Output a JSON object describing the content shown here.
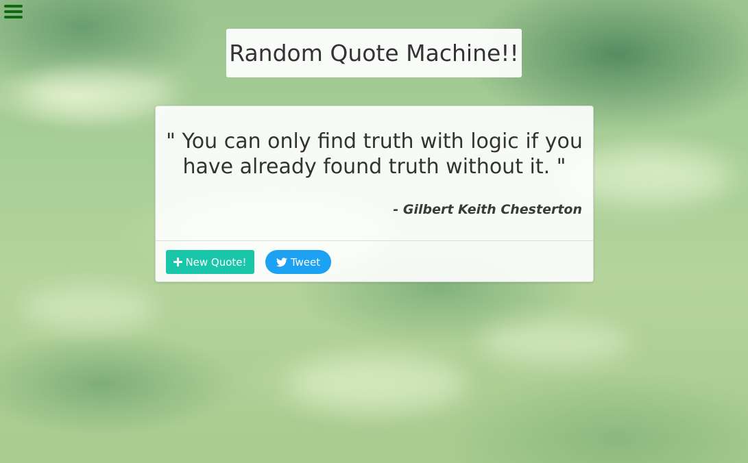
{
  "app": {
    "title": "Random Quote Machine!!"
  },
  "quote": {
    "text": "\" You can only find truth with logic if you have already found truth without it. \"",
    "author": "- Gilbert Keith Chesterton"
  },
  "actions": {
    "new_quote_label": "New Quote!",
    "new_quote_icon": "plus-icon",
    "tweet_label": "Tweet",
    "tweet_icon": "twitter-bird-icon"
  },
  "colors": {
    "menu_icon": "#0c6b10",
    "new_quote_button": "#19c6a9",
    "tweet_button": "#1da1f2",
    "text": "#333333"
  }
}
